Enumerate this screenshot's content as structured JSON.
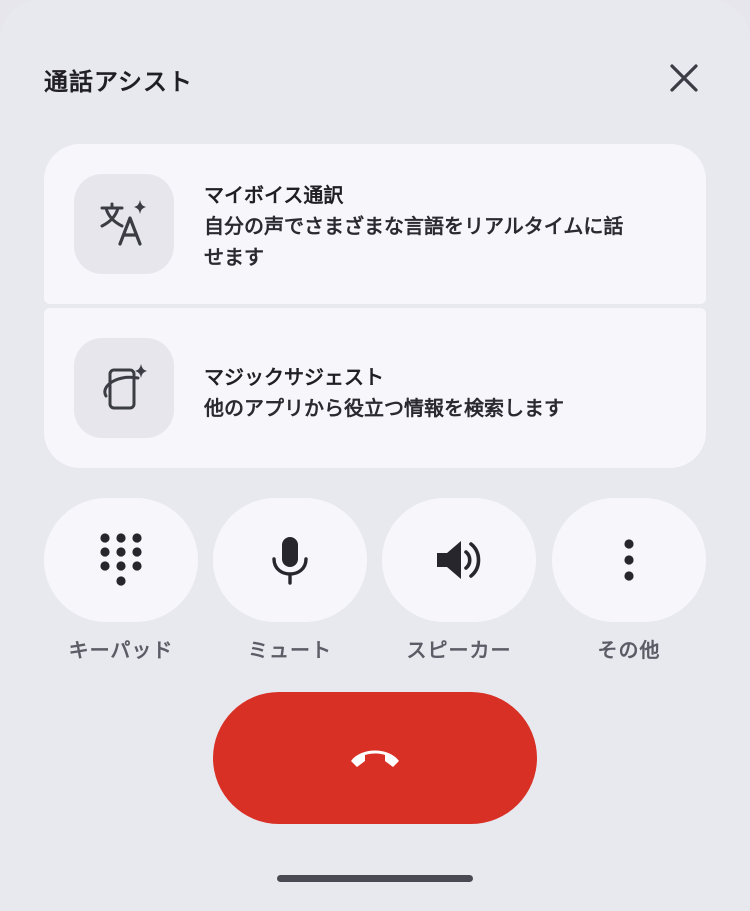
{
  "header": {
    "title": "通話アシスト"
  },
  "cards": [
    {
      "title": "マイボイス通訳",
      "description_line1": "自分の声でさまざまな言語をリアルタイムに話",
      "description_line2": "せます"
    },
    {
      "title": "マジックサジェスト",
      "description_line1": "他のアプリから役立つ情報を検索します"
    }
  ],
  "controls": {
    "keypad": "キーパッド",
    "mute": "ミュート",
    "speaker": "スピーカー",
    "more": "その他"
  },
  "colors": {
    "background": "#e8e8ef",
    "card": "#f7f7fb",
    "end_call": "#d93025",
    "text": "#1f1f24",
    "label": "#5c5c66"
  }
}
